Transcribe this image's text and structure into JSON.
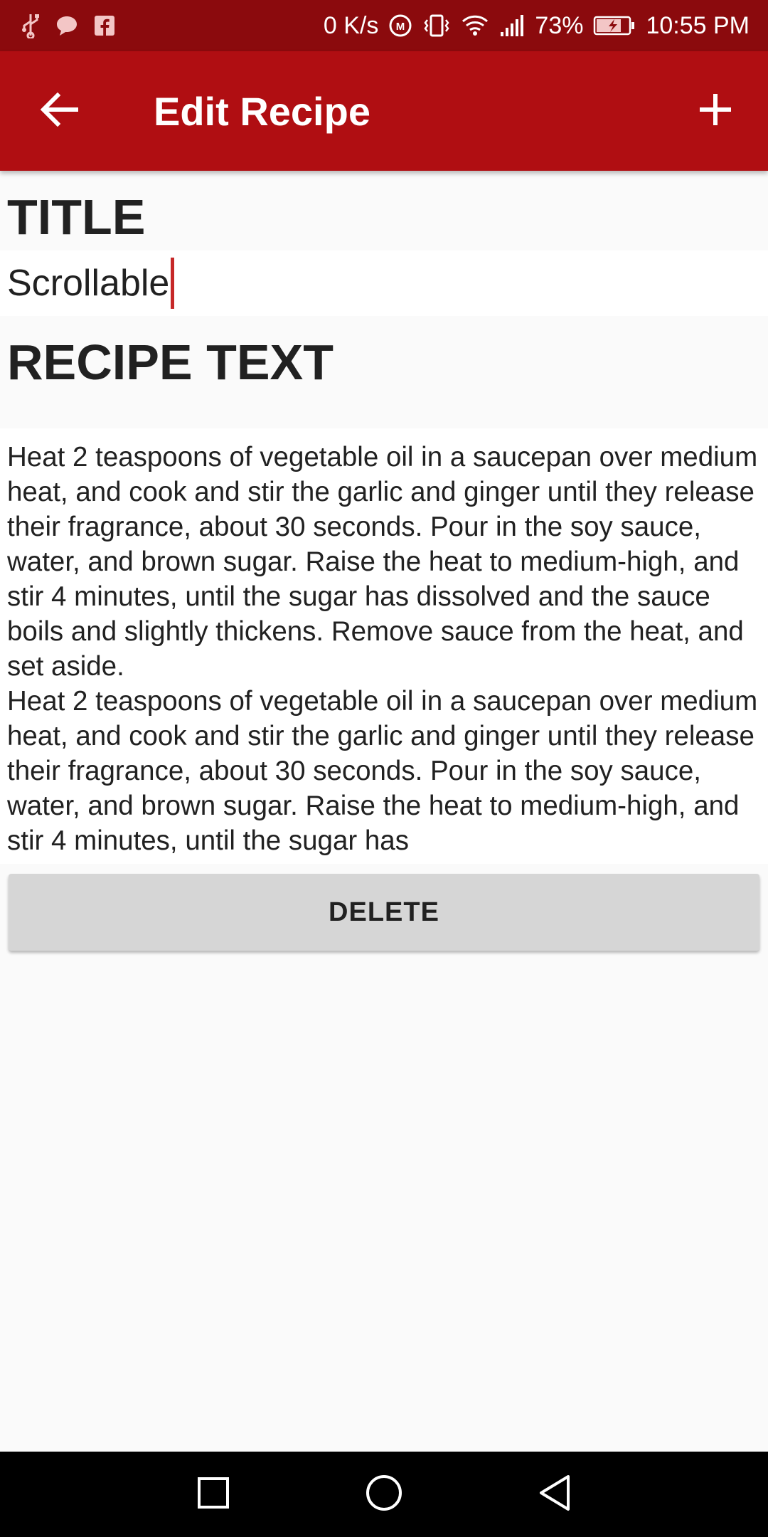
{
  "status_bar": {
    "network_speed": "0 K/s",
    "battery_percent": "73%",
    "time": "10:55 PM",
    "icons": [
      "usb-icon",
      "chat-icon",
      "facebook-icon",
      "data-saver-icon",
      "vibrate-icon",
      "wifi-icon",
      "signal-icon",
      "battery-charging-icon"
    ]
  },
  "app_bar": {
    "title": "Edit Recipe",
    "back_icon": "arrow-back-icon",
    "add_icon": "plus-icon",
    "color": "#b00e12"
  },
  "form": {
    "title_label": "TITLE",
    "title_value": "Scrollable",
    "recipe_label": "RECIPE TEXT",
    "recipe_paragraphs": [
      "Heat 2 teaspoons of vegetable oil in a saucepan over medium heat, and cook and stir the garlic and ginger until they release their fragrance, about 30 seconds. Pour in the soy sauce, water, and brown sugar. Raise the heat to medium-high, and stir 4 minutes, until the sugar has dissolved and the sauce boils and slightly thickens. Remove sauce from the heat, and set aside.",
      "Heat 2 teaspoons of vegetable oil in a saucepan over medium heat, and cook and stir the garlic and ginger until they release their fragrance, about 30 seconds. Pour in the soy sauce, water, and brown sugar. Raise the heat to medium-high, and stir 4 minutes, until the sugar has"
    ],
    "delete_label": "DELETE"
  },
  "nav_bar": {
    "icons": [
      "recents-icon",
      "home-icon",
      "back-icon"
    ]
  }
}
